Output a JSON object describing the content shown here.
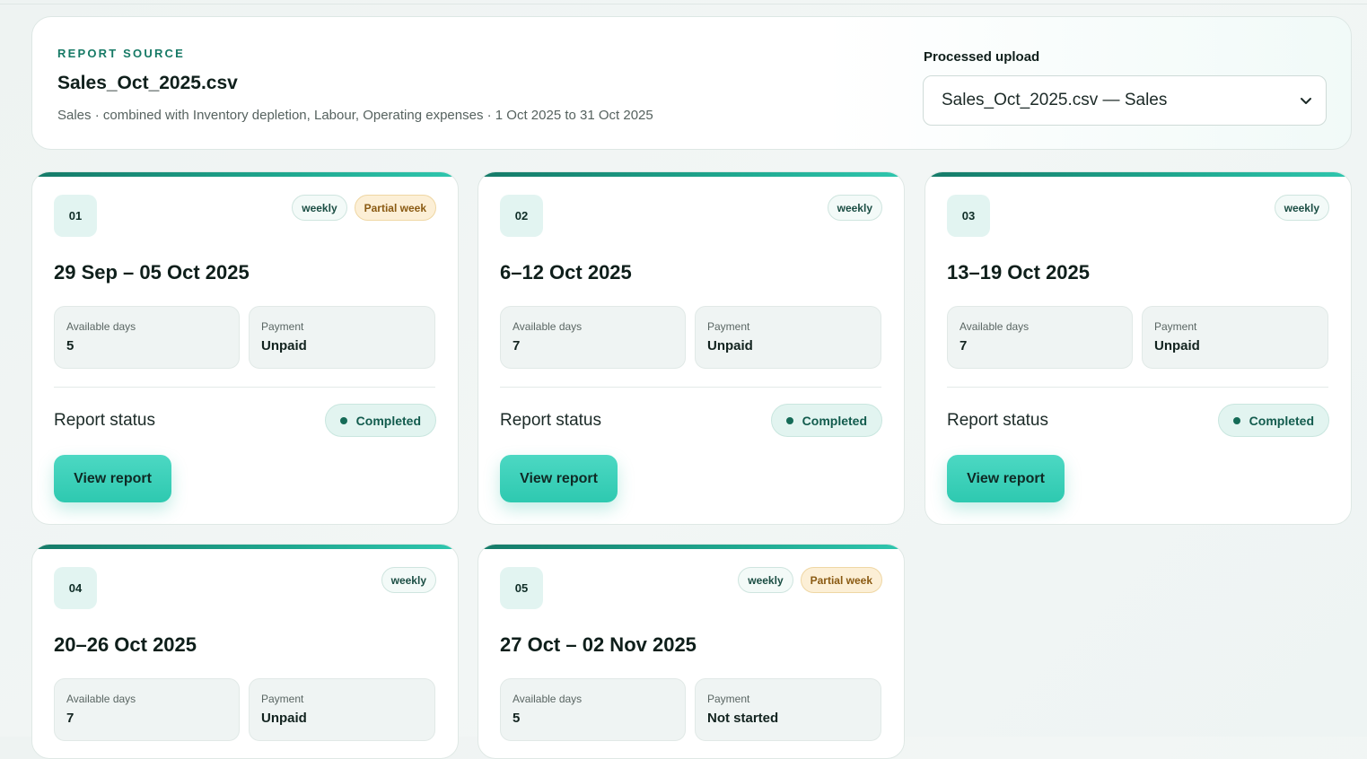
{
  "source": {
    "eyebrow": "REPORT SOURCE",
    "file_name": "Sales_Oct_2025.csv",
    "meta": "Sales · combined with Inventory depletion, Labour, Operating expenses · 1 Oct 2025 to 31 Oct 2025"
  },
  "upload": {
    "label": "Processed upload",
    "selected": "Sales_Oct_2025.csv — Sales"
  },
  "labels": {
    "available_days": "Available days",
    "payment": "Payment",
    "report_status": "Report status",
    "view_report": "View report"
  },
  "colors": {
    "accent": "#2ec9b0",
    "accent_dark": "#157a68",
    "partial_bg": "#fcefd6",
    "partial_text": "#8a5a12"
  },
  "cards": [
    {
      "index": "01",
      "range": "29 Sep – 05 Oct 2025",
      "badges": [
        "weekly",
        "Partial week"
      ],
      "available_days": "5",
      "payment": "Unpaid",
      "status": "Completed",
      "has_button": true
    },
    {
      "index": "02",
      "range": "6–12 Oct 2025",
      "badges": [
        "weekly"
      ],
      "available_days": "7",
      "payment": "Unpaid",
      "status": "Completed",
      "has_button": true
    },
    {
      "index": "03",
      "range": "13–19 Oct 2025",
      "badges": [
        "weekly"
      ],
      "available_days": "7",
      "payment": "Unpaid",
      "status": "Completed",
      "has_button": true
    },
    {
      "index": "04",
      "range": "20–26 Oct 2025",
      "badges": [
        "weekly"
      ],
      "available_days": "7",
      "payment": "Unpaid"
    },
    {
      "index": "05",
      "range": "27 Oct – 02 Nov 2025",
      "badges": [
        "weekly",
        "Partial week"
      ],
      "available_days": "5",
      "payment": "Not started"
    }
  ]
}
